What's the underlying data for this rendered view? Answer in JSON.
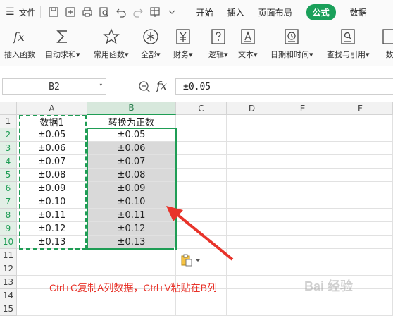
{
  "menubar": {
    "file_label": "文件",
    "tabs": [
      {
        "label": "开始",
        "active": false
      },
      {
        "label": "插入",
        "active": false
      },
      {
        "label": "页面布局",
        "active": false
      },
      {
        "label": "公式",
        "active": true
      },
      {
        "label": "数据",
        "active": false
      }
    ],
    "accent_color": "#1aa05a"
  },
  "ribbon": {
    "buttons": [
      {
        "label": "插入函数",
        "icon": "fx-icon"
      },
      {
        "label": "自动求和▾",
        "icon": "sigma-icon"
      },
      {
        "label": "常用函数▾",
        "icon": "star-icon"
      },
      {
        "label": "全部▾",
        "icon": "asterisk-icon"
      },
      {
        "label": "财务▾",
        "icon": "yen-icon"
      },
      {
        "label": "逻辑▾",
        "icon": "question-icon"
      },
      {
        "label": "文本▾",
        "icon": "text-a-icon"
      },
      {
        "label": "日期和时间▾",
        "icon": "clock-icon"
      },
      {
        "label": "查找与引用▾",
        "icon": "search-book-icon"
      },
      {
        "label": "数",
        "icon": "math-icon"
      }
    ]
  },
  "formula_bar": {
    "name_box": "B2",
    "fx_label": "fx",
    "content": "±0.05"
  },
  "sheet": {
    "columns": [
      "A",
      "B",
      "C",
      "D",
      "E",
      "F"
    ],
    "selected_column": "B",
    "rows": [
      "1",
      "2",
      "3",
      "4",
      "5",
      "6",
      "7",
      "8",
      "9",
      "10",
      "11",
      "12",
      "13",
      "14",
      "15"
    ],
    "col_a": [
      "数据1",
      "±0.05",
      "±0.06",
      "±0.07",
      "±0.08",
      "±0.09",
      "±0.10",
      "±0.11",
      "±0.12",
      "±0.13"
    ],
    "col_b": [
      "转换为正数",
      "±0.05",
      "±0.06",
      "±0.07",
      "±0.08",
      "±0.09",
      "±0.10",
      "±0.11",
      "±0.12",
      "±0.13"
    ],
    "selection_color": "#1f9d55"
  },
  "annotation": {
    "text": "Ctrl+C复制A列数据，Ctrl+V粘贴在B列",
    "color": "#e8332a"
  },
  "watermark": {
    "text": "Bai 经验"
  }
}
